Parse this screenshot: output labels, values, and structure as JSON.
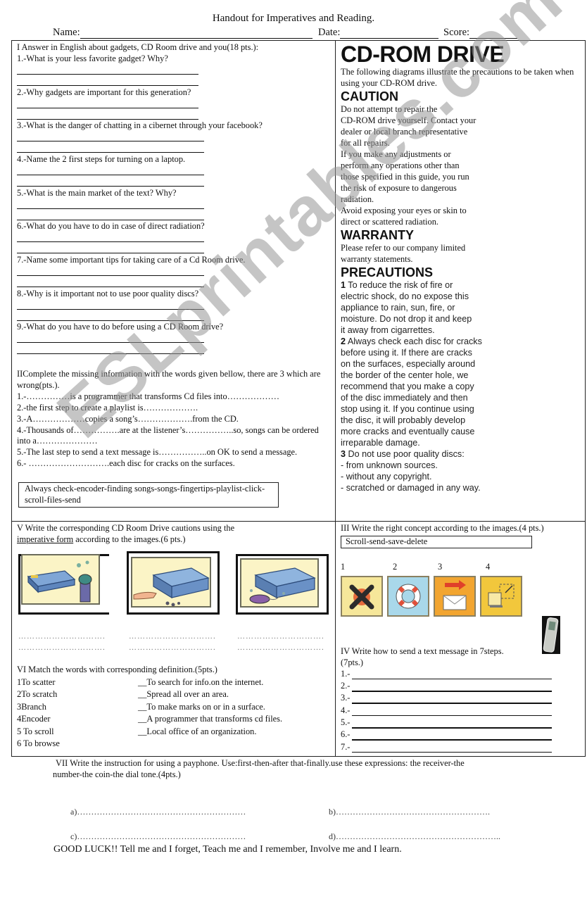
{
  "header": {
    "title": "Handout for Imperatives and Reading.",
    "name_label": "Name:",
    "date_label": "Date:",
    "score_label": "Score:"
  },
  "section1": {
    "heading": "I Answer in English about  gadgets, CD Room drive  and you(18 pts.):",
    "questions": [
      "1.-What is your less favorite gadget? Why?",
      "2.-Why gadgets are important for this generation?",
      "3.-What is the danger of chatting in a cibernet through your facebook?",
      "4.-Name the 2 first steps for turning on a laptop.",
      "5.-What is the main market of the text? Why?",
      "6.-What do you have to do in case of direct radiation?",
      "7.-Name some important tips for taking care of a Cd Room drive.",
      "8.-Why is it important not to use poor quality discs?",
      "9.-What do you have to do before using a CD Room drive?"
    ]
  },
  "section2": {
    "heading": "IIComplete the missing information with the words given bellow, there are 3 which are wrong(pts.).",
    "items": [
      "1.-……………is a programmer that transforms Cd files into………………",
      "2.-the first step to create a playlist is……………….",
      "3.-A………………copies a song’s……………….from the CD.",
      "4.-Thousands of…………….are at the listener’s……………..so, songs can be ordered into a…………………",
      "5.-The last step to send a text message is……………..on OK  to send a message.",
      "6.- ……………………….each disc for cracks on the surfaces."
    ],
    "word_bank": "Always check-encoder-finding songs-songs-fingertips-playlist-click-scroll-files-send"
  },
  "reading": {
    "title": "CD-ROM DRIVE",
    "intro": "The following diagrams illustrate the precautions to be taken when using your CD-ROM drive.",
    "caution_heading": "CAUTION",
    "caution_lines": [
      "Do not attempt to repair the",
      "CD-ROM drive yourself. Contact your",
      "dealer or local branch representative",
      "for all repairs.",
      "If you make any adjustments or",
      "perform any operations other than",
      "those specified in this guide, you run",
      "the risk of exposure to dangerous",
      "radiation.",
      "Avoid exposing your eyes or skin to",
      "direct or scattered radiation."
    ],
    "warranty_heading": "WARRANTY",
    "warranty_lines": [
      "Please refer to our company limited",
      "warranty statements."
    ],
    "precautions_heading": "PRECAUTIONS",
    "precautions": [
      {
        "num": "1",
        "lines": [
          " To reduce the risk of fire or",
          "electric shock, do no expose this",
          "appliance to rain, sun, fire, or",
          "moisture. Do not drop it and keep",
          "it away from cigarrettes."
        ]
      },
      {
        "num": "2",
        "lines": [
          " Always check each disc for cracks",
          "before using it. If there are cracks",
          "on the surfaces, especially around",
          "the border of the center hole, we",
          "recommend that you make a copy",
          "of the disc immediately and then",
          "stop using it. If you continue using",
          "the disc, it will probably develop",
          "more cracks and eventually cause",
          "irreparable damage."
        ]
      },
      {
        "num": "3",
        "lines": [
          " Do not use poor quality discs:",
          "- from unknown sources.",
          "- without any copyright.",
          "- scratched or damaged in any way."
        ]
      }
    ]
  },
  "section5": {
    "heading_line1": "V Write the corresponding CD Room Drive cautions using  the",
    "heading_underlined": "imperative form",
    "heading_line2_rest": " according to the images.(6 pts.)",
    "images": [
      "cd-drive-near-heater",
      "cd-drive-dropped-pieces",
      "cd-drive-near-cigarette"
    ],
    "dots": "…………………………."
  },
  "section6": {
    "heading": "VI Match the words with corresponding definition.(5pts.)",
    "words": [
      "1To scatter",
      "2To scratch",
      "3Branch",
      "4Encoder",
      "5 To scroll",
      "6 To browse"
    ],
    "definitions": [
      "__To search for info.on the internet.",
      "__Spread all over an area.",
      "__To make marks on or in a surface.",
      "__A programmer that transforms cd files.",
      "__Local office of an organization."
    ]
  },
  "section3": {
    "heading": "III Write  the right concept according to the images.(4 pts.)",
    "word_bank": "Scroll-send-save-delete",
    "numbers": [
      "1",
      "2",
      "3",
      "4"
    ],
    "icons": [
      "delete-x-icon",
      "lifebuoy-icon",
      "send-envelope-icon",
      "scroll-resize-icon"
    ]
  },
  "section4": {
    "heading": "IV Write how to send a text message in 7steps.",
    "points": "(7pts.)",
    "steps": [
      "1.-",
      "2.-",
      "3.-",
      "4.-",
      "5.-",
      "6.-",
      "7.-"
    ]
  },
  "section7": {
    "heading_line1": "VII Write the instruction for using a payphone. Use:first-then-after that-finally.use these expressions: the receiver-the",
    "heading_line2": "number-the coin-the dial tone.(4pts.)",
    "blanks": [
      "a)……………………………………………………",
      "b)……………………………………………….",
      "c)……………………………………………………",
      "d)………………………………………………….."
    ]
  },
  "footer": {
    "closing": "GOOD LUCK!! Tell me and I forget, Teach me and I remember, Involve me and I learn."
  },
  "watermark": "ESLprintables.com",
  "colors": {
    "tile_yellow": "#f6e79a",
    "tile_blue": "#a9d8ea",
    "tile_orange": "#f2a530",
    "tile_gold": "#f2c73c",
    "picture_bg": "#fbf4c6",
    "watermark": "#969696"
  }
}
